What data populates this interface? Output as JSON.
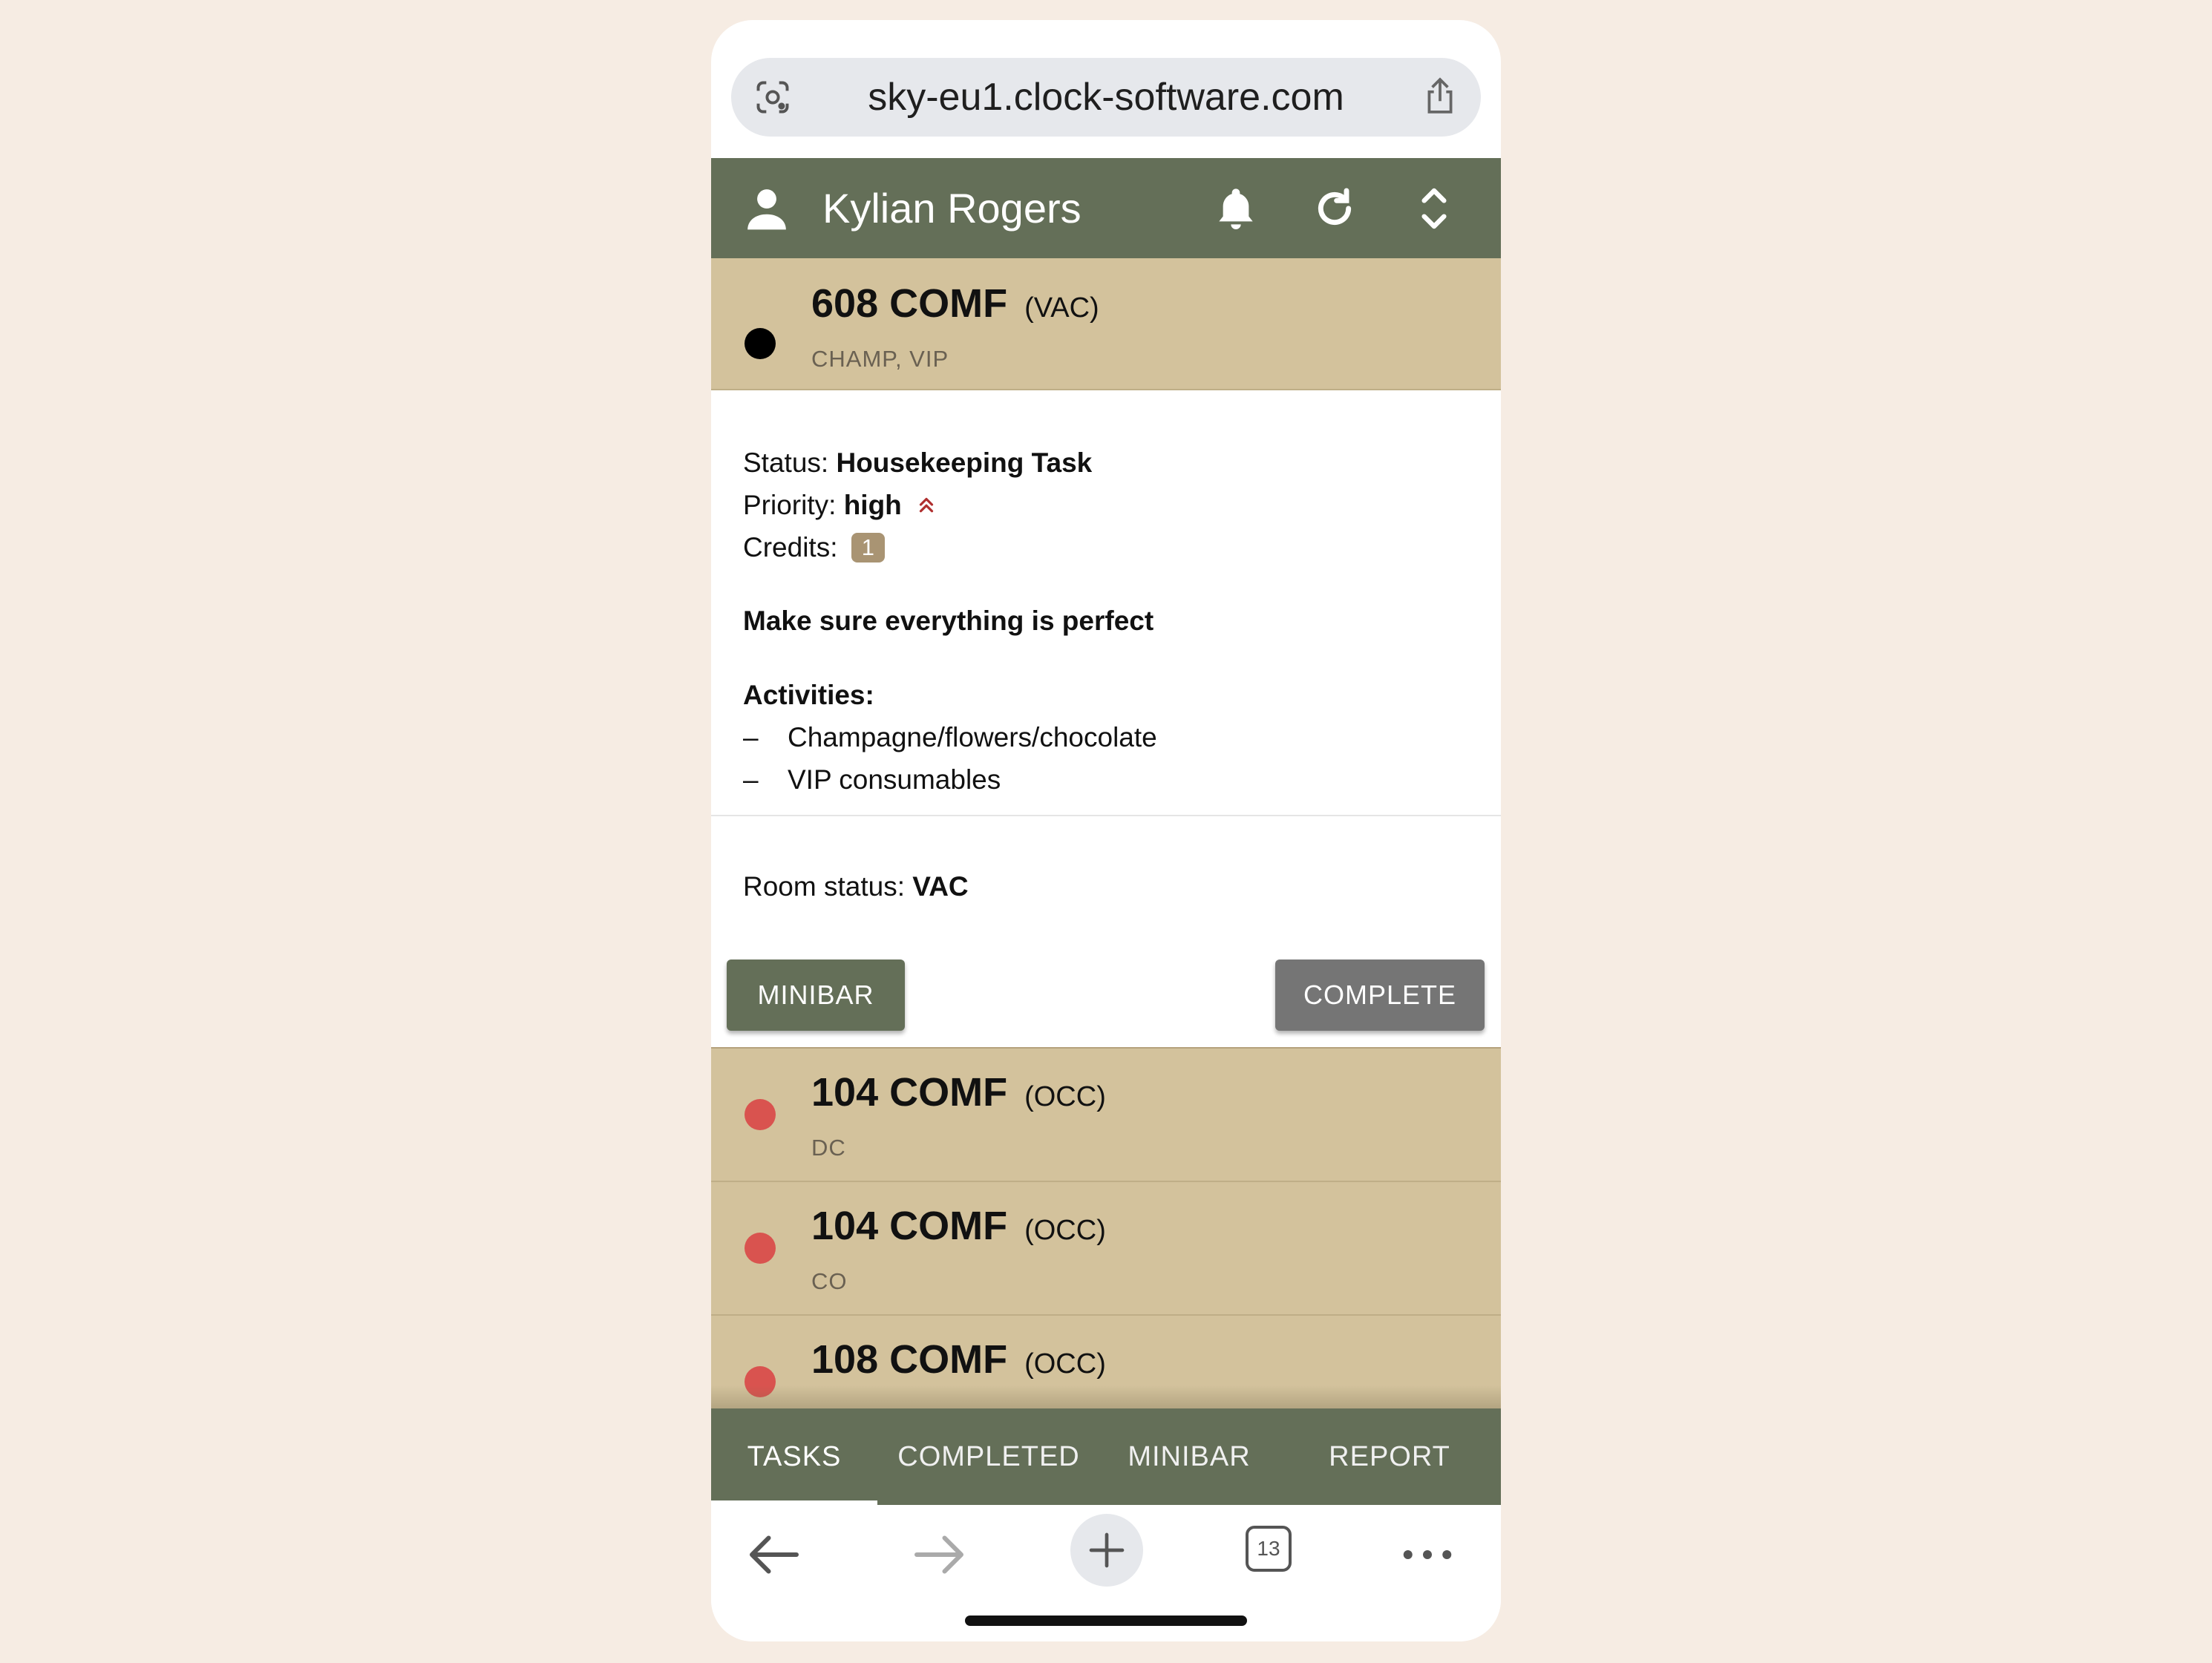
{
  "browser": {
    "url": "sky-eu1.clock-software.com",
    "tab_count": "13"
  },
  "header": {
    "user_name": "Kylian Rogers"
  },
  "current_task": {
    "room": "608 COMF",
    "room_status_short": "(VAC)",
    "tags": "CHAMP, VIP",
    "dot_color": "#000000",
    "status_label": "Status:",
    "status_value": "Housekeeping Task",
    "priority_label": "Priority:",
    "priority_value": "high",
    "credits_label": "Credits:",
    "credits_value": "1",
    "note": "Make sure everything is perfect",
    "activities_label": "Activities:",
    "activities": [
      "Champagne/flowers/chocolate",
      "VIP consumables"
    ],
    "room_status_label": "Room status:",
    "room_status_value": "VAC",
    "minibar_button": "MINIBAR",
    "complete_button": "COMPLETE"
  },
  "task_list": [
    {
      "room": "104 COMF",
      "status": "(OCC)",
      "tags": "DC",
      "dot_color": "#d9534f"
    },
    {
      "room": "104 COMF",
      "status": "(OCC)",
      "tags": "CO",
      "dot_color": "#d9534f"
    },
    {
      "room": "108 COMF",
      "status": "(OCC)",
      "tags": "",
      "dot_color": "#d9534f"
    }
  ],
  "bottom_nav": {
    "tabs": [
      "TASKS",
      "COMPLETED",
      "MINIBAR",
      "REPORT"
    ],
    "active": "TASKS"
  },
  "colors": {
    "header_bg": "#646f58",
    "task_row_bg": "#d3c29c",
    "priority_high": "#b03030",
    "credit_badge": "#a99473"
  }
}
